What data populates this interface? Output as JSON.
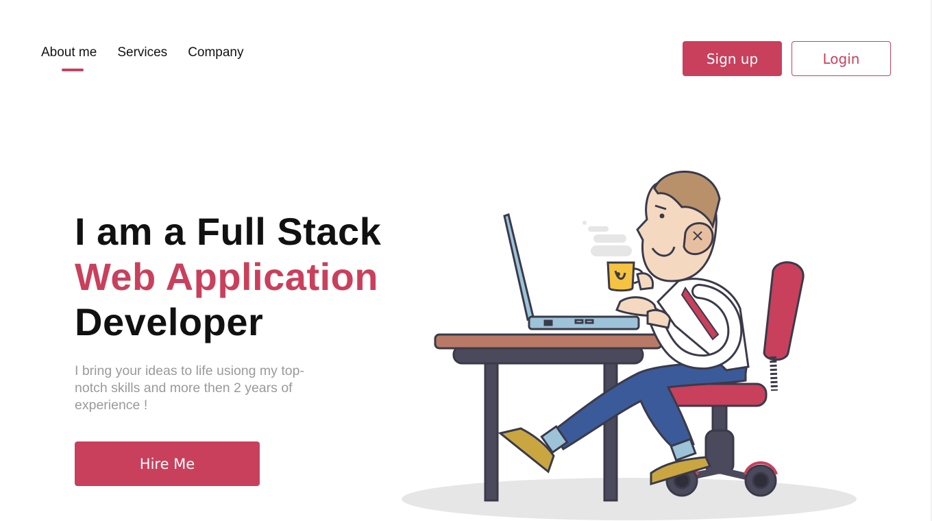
{
  "nav": {
    "items": [
      {
        "label": "About me",
        "active": true
      },
      {
        "label": "Services",
        "active": false
      },
      {
        "label": "Company",
        "active": false
      }
    ]
  },
  "auth": {
    "signup_label": "Sign up",
    "login_label": "Login"
  },
  "hero": {
    "line1": "I am a Full Stack",
    "line2": "Web Application",
    "line3": "Developer",
    "description": "I bring your ideas to life usiong my top-notch skills and more then 2 years of experience !",
    "cta_label": "Hire Me"
  },
  "colors": {
    "accent": "#c9405c",
    "text": "#111111",
    "muted": "#9a9a9a"
  },
  "illustration": {
    "icon": "developer-at-desk-illustration"
  }
}
